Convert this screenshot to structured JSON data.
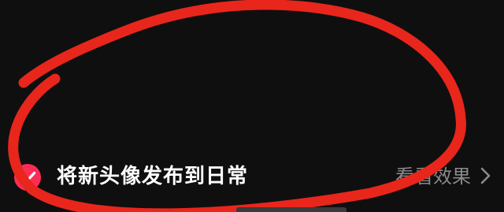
{
  "option": {
    "checked": true,
    "label": "将新头像发布到日常",
    "link_label": "看看效果"
  },
  "icons": {
    "checkbox": "check-circle-icon",
    "arrow": "chevron-right-icon"
  },
  "colors": {
    "background": "#0f0f0f",
    "accent": "#fe2c55",
    "annotation": "#e8261c",
    "link_text": "#8a8a8a"
  }
}
